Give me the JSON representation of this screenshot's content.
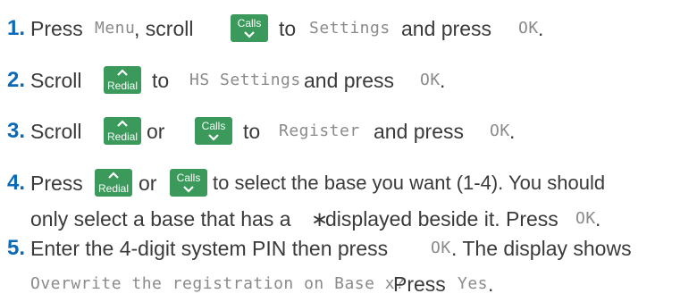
{
  "colors": {
    "step_number": "#0a6ab8",
    "key_background": "#3b9a5b",
    "body_text": "#3a3a3a",
    "display_text": "#8a8a8a"
  },
  "keys": {
    "calls": "Calls",
    "redial": "Redial"
  },
  "steps": [
    {
      "number": "1.",
      "t1": "Press ",
      "d1": "Menu",
      "t2": ", scroll ",
      "t3": " to ",
      "d2": "Settings",
      "t4": " and press ",
      "d3": "OK",
      "t5": "."
    },
    {
      "number": "2.",
      "t1": "Scroll ",
      "t2": " to ",
      "d1": "HS Settings",
      "t3": " and press ",
      "d2": "OK",
      "t4": "."
    },
    {
      "number": "3.",
      "t1": "Scroll ",
      "t2": " or ",
      "t3": " to ",
      "d1": "Register",
      "t4": " and press ",
      "d2": "OK",
      "t5": "."
    },
    {
      "number": "4.",
      "t1": "Press ",
      "t2": " or ",
      "t3": " to select the base you want (1-4). You should",
      "line2a": "only select a base that has a ",
      "star": "∗",
      "line2b": " displayed beside it. Press ",
      "d1": "OK",
      "line2c": "."
    },
    {
      "number": "5.",
      "t1": "Enter the 4-digit system PIN then press ",
      "d1": "OK",
      "t2": ". The display shows",
      "d2": "Overwrite the registration on Base x?",
      "t3": " Press ",
      "d3": "Yes",
      "t4": "."
    }
  ]
}
